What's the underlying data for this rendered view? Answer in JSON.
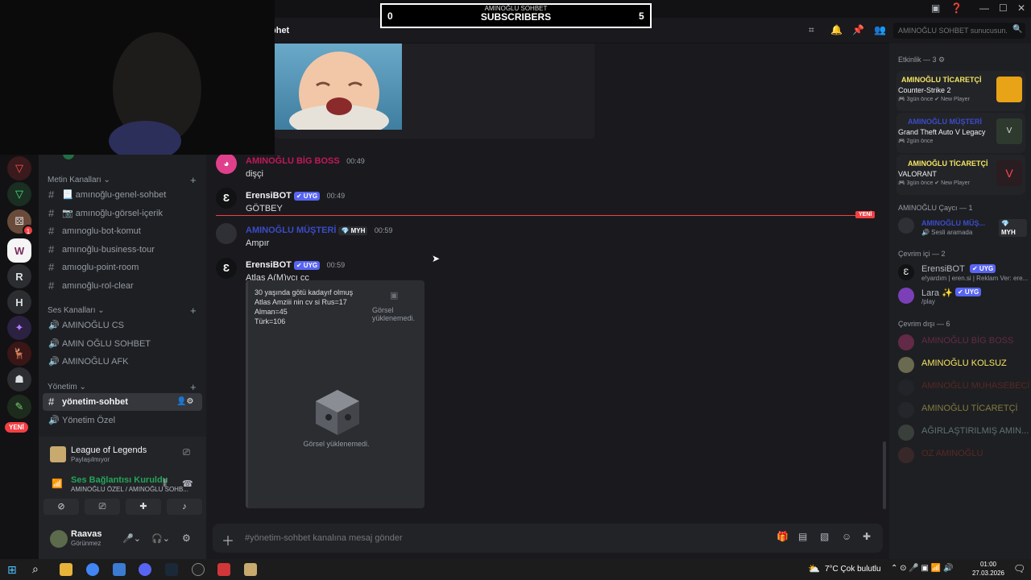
{
  "overlay": {
    "label": "AMINOĞLU SOHBET",
    "title": "SUBSCRIBERS",
    "left_count": "0",
    "right_count": "5"
  },
  "header": {
    "channel_fragment": "bhet",
    "search_placeholder": "AMINOĞLU SOHBET sunucusun..."
  },
  "sidebar": {
    "categories": {
      "text": "Metin Kanalları",
      "voice": "Ses Kanalları",
      "admin": "Yönetim"
    },
    "text_channels": [
      "📃 amınoğlu-genel-sohbet",
      "📷 amınoğlu-görsel-içerik",
      "amınoglu-bot-komut",
      "amınoğlu-business-tour",
      "amıoglu-point-room",
      "amınoğlu-rol-clear"
    ],
    "voice_channels": [
      "AMINOĞLU CS",
      "AMIN OĞLU SOHBET",
      "AMINOĞLU AFK"
    ],
    "admin_channels": [
      "yönetim-sohbet",
      "Yönetim Özel"
    ],
    "new_badge": "YENİ",
    "mention_count": "1",
    "rail_letters": [
      "R",
      "H"
    ],
    "activity": {
      "game": "League of Legends",
      "status": "Paylaşılmıyor"
    },
    "voice_status": {
      "title": "Ses Bağlantısı Kuruldu",
      "detail": "AMINOĞLU ÖZEL / AMINOĞLU SOHB..."
    },
    "user": {
      "name": "Raavas",
      "status": "Görünmez"
    }
  },
  "messages": [
    {
      "author": "AMINOĞLU BİG BOSS",
      "time": "00:49",
      "text": "dişçi",
      "color": "#c2185b"
    },
    {
      "author": "ErensiBOT",
      "badge": "✔ UYG",
      "time": "00:49",
      "text": "GÖTBEY",
      "color": "#f2f3f5"
    },
    {
      "author": "AMINOĞLU MÜŞTERİ",
      "badge": "💎 MYH",
      "time": "00:59",
      "text": "Ampır",
      "color": "#3b4cca"
    },
    {
      "author": "ErensiBOT",
      "badge": "✔ UYG",
      "time": "00:59",
      "text": "Atlas A(M)vcı cc",
      "color": "#f2f3f5"
    }
  ],
  "new_divider": "YENİ",
  "embed": {
    "lines": [
      "30 yaşında götü kadayıf olmuş",
      "Atlas Amziii nin cv si Rus=17",
      "Alman=45",
      "Türk=106"
    ],
    "thumb_error": "Görsel yüklenemedi.",
    "image_error": "Görsel yüklenemedi."
  },
  "composer": {
    "placeholder": "#yönetim-sohbet kanalına mesaj gönder"
  },
  "members": {
    "activity_header": "Etkinlik — 3 ⚙",
    "activities": [
      {
        "user": "AMINOĞLU TİCARETÇİ",
        "game": "Counter-Strike 2",
        "meta": "🎮 3gün önce  ✔ New Player"
      },
      {
        "user": "AMINOĞLU MÜŞTERİ",
        "game": "Grand Theft Auto V Legacy",
        "meta": "🎮 2gün önce"
      },
      {
        "user": "AMINOĞLU TİCARETÇİ",
        "game": "VALORANT",
        "meta": "🎮 3gün önce  ✔ New Player"
      }
    ],
    "player_header": "AMINOĞLU Çaycı — 1",
    "player": {
      "name": "AMINOĞLU MÜŞ...",
      "badge": "💎 MYH",
      "sub": "🔊 Sesli aramada"
    },
    "online_header": "Çevrim içi — 2",
    "online": [
      {
        "name": "ErensiBOT",
        "badge": "✔ UYG",
        "sub": "e!yardım | eren.si | Reklam Ver: ere..."
      },
      {
        "name": "Lara ✨",
        "badge": "✔ UYG",
        "sub": "/play"
      }
    ],
    "offline_header": "Çevrim dışı — 6",
    "offline": [
      "AMINOĞLU BİG BOSS",
      "AMINOĞLU KOLSUZ",
      "AMINOĞLU MUHASEBECİ",
      "AMINOĞLU TİCARETÇİ",
      "AĞIRLAŞTIRILMIŞ AMIN...",
      "OZ AMINOĞLU"
    ]
  },
  "taskbar": {
    "weather": "7°C  Çok bulutlu",
    "time": "01:00",
    "date": "27.03.2026"
  }
}
